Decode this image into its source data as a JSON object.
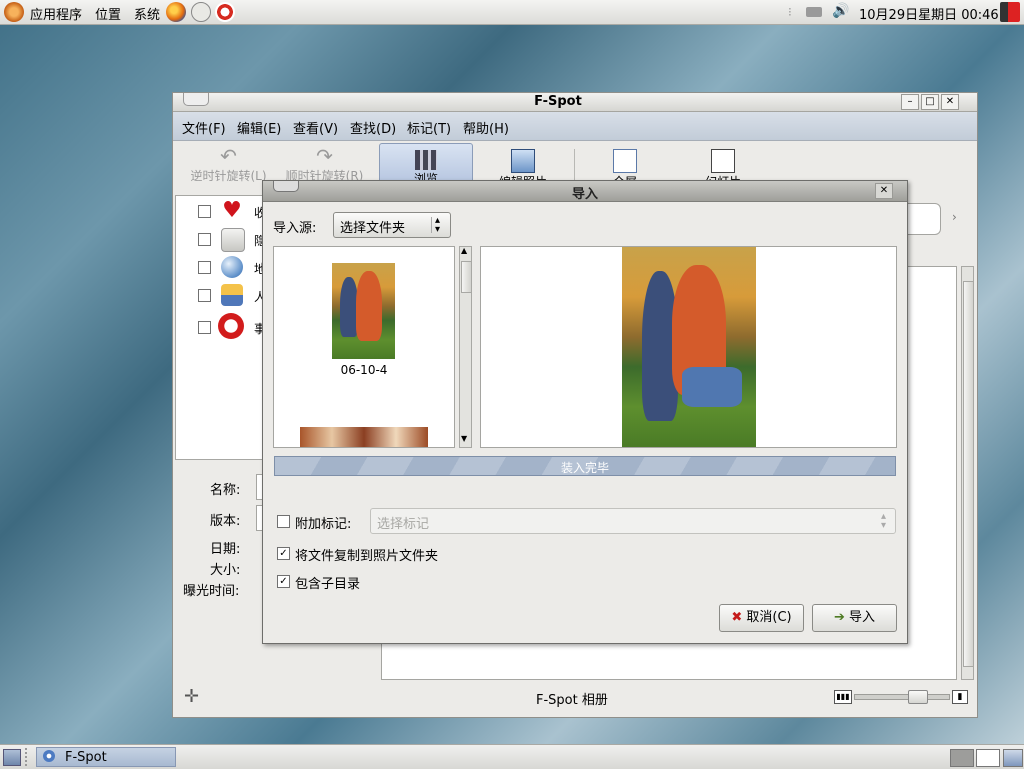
{
  "top_panel": {
    "menus": [
      "应用程序",
      "位置",
      "系统"
    ],
    "clock": "10月29日星期日 00:46"
  },
  "main_window": {
    "title": "F-Spot",
    "menus": [
      "文件(F)",
      "编辑(E)",
      "查看(V)",
      "查找(D)",
      "标记(T)",
      "帮助(H)"
    ],
    "toolbar": {
      "rotate_left": "逆时针旋转(L)",
      "rotate_right": "顺时针旋转(R)",
      "browse": "浏览",
      "edit_photo": "编辑照片",
      "fullscreen": "全屏",
      "slideshow": "幻灯片"
    },
    "sidebar_categories": [
      {
        "label": "收藏",
        "icon": "heart-icon"
      },
      {
        "label": "隐藏",
        "icon": "lock-icon"
      },
      {
        "label": "地点",
        "icon": "globe-icon"
      },
      {
        "label": "人物",
        "icon": "people-icon"
      },
      {
        "label": "事件",
        "icon": "clock-icon"
      }
    ],
    "info_labels": {
      "name": "名称:",
      "version": "版本:",
      "date": "日期:",
      "size": "大小:",
      "exposure": "曝光时间:"
    },
    "status_text": "F-Spot 相册",
    "zoom": 0.72
  },
  "import_dialog": {
    "title": "导入",
    "source_label": "导入源:",
    "source_value": "选择文件夹",
    "thumb_caption": "06-10-4",
    "progress_text": "装入完毕",
    "attach_tag_label": "附加标记:",
    "attach_tag_placeholder": "选择标记",
    "attach_tag_checked": false,
    "copy_files_label": "将文件复制到照片文件夹",
    "copy_files_checked": true,
    "include_subdirs_label": "包含子目录",
    "include_subdirs_checked": true,
    "cancel_label": "取消(C)",
    "import_label": "导入"
  },
  "bottom_panel": {
    "task_label": "F-Spot"
  }
}
